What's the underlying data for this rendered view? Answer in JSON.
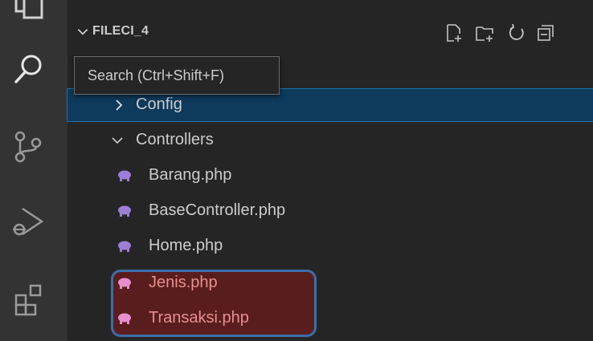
{
  "activity_bar": {
    "icons": [
      "explorer-icon",
      "search-icon",
      "source-control-icon",
      "run-debug-icon",
      "extensions-icon"
    ]
  },
  "explorer": {
    "section_title": "FILECI_4",
    "actions": [
      "new-file-icon",
      "new-folder-icon",
      "refresh-icon",
      "collapse-all-icon"
    ],
    "tree": [
      {
        "label": "Config",
        "type": "folder",
        "expanded": false,
        "selected": true
      },
      {
        "label": "Controllers",
        "type": "folder",
        "expanded": true
      },
      {
        "label": "Barang.php",
        "type": "file"
      },
      {
        "label": "BaseController.php",
        "type": "file"
      },
      {
        "label": "Home.php",
        "type": "file"
      },
      {
        "label": "Jenis.php",
        "type": "file",
        "highlighted": true
      },
      {
        "label": "Transaksi.php",
        "type": "file",
        "highlighted": true
      }
    ]
  },
  "tooltip": {
    "text": "Search (Ctrl+Shift+F)"
  },
  "colors": {
    "selection": "#0e3a5c",
    "highlight_fill": "#5a1d1d",
    "highlight_border": "#3c6ea8",
    "php_icon": "#9b7fd6",
    "php_icon_highlighted": "#e58fcf"
  }
}
